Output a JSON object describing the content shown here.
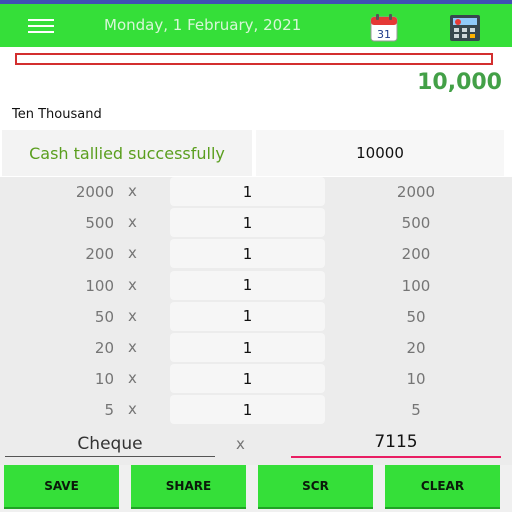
{
  "header": {
    "date": "Monday, 1 February, 2021",
    "calendar_day": "31",
    "menu_icon": "hamburger-menu-icon",
    "calendar_icon": "calendar-icon",
    "calculator_icon": "calculator-icon"
  },
  "total": "10,000",
  "total_words": "Ten Thousand",
  "status": "Cash tallied successfully",
  "sum_field": "10000",
  "rows": [
    {
      "denom": "2000",
      "times": "x",
      "qty": "1",
      "amount": "2000"
    },
    {
      "denom": "500",
      "times": "x",
      "qty": "1",
      "amount": "500"
    },
    {
      "denom": "200",
      "times": "x",
      "qty": "1",
      "amount": "200"
    },
    {
      "denom": "100",
      "times": "x",
      "qty": "1",
      "amount": "100"
    },
    {
      "denom": "50",
      "times": "x",
      "qty": "1",
      "amount": "50"
    },
    {
      "denom": "20",
      "times": "x",
      "qty": "1",
      "amount": "20"
    },
    {
      "denom": "10",
      "times": "x",
      "qty": "1",
      "amount": "10"
    },
    {
      "denom": "5",
      "times": "x",
      "qty": "1",
      "amount": "5"
    }
  ],
  "cheque": {
    "label": "Cheque",
    "times": "x",
    "value": "7115"
  },
  "buttons": {
    "save": "SAVE",
    "share": "SHARE",
    "scr": "SCR",
    "clear": "CLEAR"
  },
  "colors": {
    "appbar": "#35df39",
    "total_text": "#43a047",
    "status_text": "#5a9e1e",
    "error_border": "#d32f2f",
    "accent_underline": "#e91e63"
  }
}
